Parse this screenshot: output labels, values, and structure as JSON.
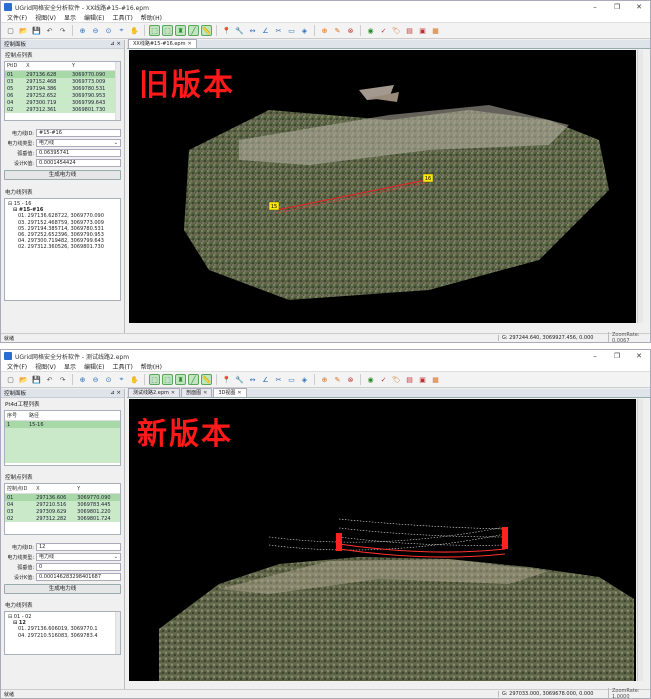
{
  "old": {
    "title": "UGrid网格安全分析软件 - XX线路#15-#16.epm",
    "menu": [
      "文件(F)",
      "视图(V)",
      "显示",
      "编辑(E)",
      "工具(T)",
      "帮助(H)"
    ],
    "panel_title": "控制面板",
    "pin": "⊿ ×",
    "ctrl_list_label": "控制点列表",
    "ctrl_headers": [
      "PtID",
      "X",
      "Y"
    ],
    "ctrl_rows": [
      [
        "01",
        "297136.628",
        "3069770.090"
      ],
      [
        "03",
        "297152.468",
        "3069773.009"
      ],
      [
        "05",
        "297194.386",
        "3069780.531"
      ],
      [
        "06",
        "297252.652",
        "3069790.953"
      ],
      [
        "04",
        "297300.719",
        "3069799.643"
      ],
      [
        "02",
        "297312.361",
        "3069801.730"
      ]
    ],
    "fields": [
      {
        "label": "电力线ID:",
        "value": "#15-#16"
      },
      {
        "label": "电力线类型:",
        "value": "电力线",
        "select": true
      },
      {
        "label": "弧垂值:",
        "value": "0.06395741"
      },
      {
        "label": "设计K值:",
        "value": "0.0001454424"
      }
    ],
    "gen_button": "生成电力线",
    "line_list_label": "电力线列表",
    "tree": [
      {
        "t": "⊟ 15 - 16",
        "b": false,
        "i": 0
      },
      {
        "t": "⊟ #15-#16",
        "b": true,
        "i": 1
      },
      {
        "t": "01. 297136.628722, 3069770.090",
        "b": false,
        "i": 2
      },
      {
        "t": "03. 297152.468759, 3069773.009",
        "b": false,
        "i": 2
      },
      {
        "t": "05. 297194.385714, 3069780.531",
        "b": false,
        "i": 2
      },
      {
        "t": "06. 297252.652396, 3069790.953",
        "b": false,
        "i": 2
      },
      {
        "t": "04. 297300.719482, 3069799.643",
        "b": false,
        "i": 2
      },
      {
        "t": "02. 297312.360526, 3069801.730",
        "b": false,
        "i": 2
      }
    ],
    "tabs": [
      {
        "label": "XX线路#15-#16.epm",
        "active": true
      }
    ],
    "stamp": "旧版本",
    "tower_labels": [
      "15",
      "16"
    ],
    "status": {
      "ready": "就绪",
      "coord": "G: 297244.640, 3069927.456, 0.000",
      "zoom": "ZoomRate: 0.0067"
    }
  },
  "new": {
    "title": "UGrid网格安全分析软件 - 测试线路2.epm",
    "menu": [
      "文件(F)",
      "视图(V)",
      "显示",
      "编辑(E)",
      "工具(T)",
      "帮助(H)"
    ],
    "panel_title": "控制面板",
    "pin": "⊿ ×",
    "pair_list_label": "Pt4d工程列表",
    "pair_headers": [
      "序号",
      "路径"
    ],
    "pair_rows": [
      [
        "1",
        "15-16"
      ]
    ],
    "ctrl_list_label": "控制点列表",
    "ctrl_headers": [
      "控制点ID",
      "X",
      "Y"
    ],
    "ctrl_rows": [
      [
        "01",
        "297136.606",
        "3069770.090"
      ],
      [
        "04",
        "297210.516",
        "3069783.445"
      ],
      [
        "03",
        "297309.629",
        "3069801.220"
      ],
      [
        "02",
        "297312.282",
        "3069801.724"
      ]
    ],
    "fields": [
      {
        "label": "电力线ID:",
        "value": "12"
      },
      {
        "label": "电力线类型:",
        "value": "电力线",
        "select": true
      },
      {
        "label": "弧垂值:",
        "value": "0"
      },
      {
        "label": "设计K值:",
        "value": "0.000146283298401687"
      }
    ],
    "gen_button": "生成电力线",
    "line_list_label": "电力线列表",
    "tree": [
      {
        "t": "⊟ 01 - 02",
        "b": false,
        "i": 0
      },
      {
        "t": "⊟ 12",
        "b": true,
        "i": 1
      },
      {
        "t": "01. 297136.606019, 3069770.1",
        "b": false,
        "i": 2
      },
      {
        "t": "04. 297210.516083, 3069783.4",
        "b": false,
        "i": 2
      }
    ],
    "tabs": [
      {
        "label": "测试线路2.epm",
        "active": false
      },
      {
        "label": "剖面图",
        "active": false
      },
      {
        "label": "3D视图",
        "active": true
      }
    ],
    "stamp": "新版本",
    "status": {
      "ready": "就绪",
      "coord": "G: 297033.000, 3069678.000, 0.000",
      "zoom": "ZoomRate: 1.0000"
    }
  },
  "toolbar_icons": [
    "new-file-icon",
    "open-icon",
    "save-icon",
    "undo-icon",
    "redo-icon",
    "zoom-in-icon",
    "zoom-out-icon",
    "zoom-extent-icon",
    "zoom-window-icon",
    "pan-hand-icon",
    "select-icon",
    "select-box-icon",
    "tower-icon",
    "line-icon",
    "measure-icon",
    "pin-icon",
    "wrench-icon",
    "distance-icon",
    "angle-icon",
    "clip-icon",
    "profile-icon",
    "layer-icon",
    "add-icon",
    "edit-icon",
    "delete-icon",
    "eye-icon",
    "check-icon",
    "tag-icon",
    "report-icon",
    "export-icon",
    "chart-icon"
  ]
}
